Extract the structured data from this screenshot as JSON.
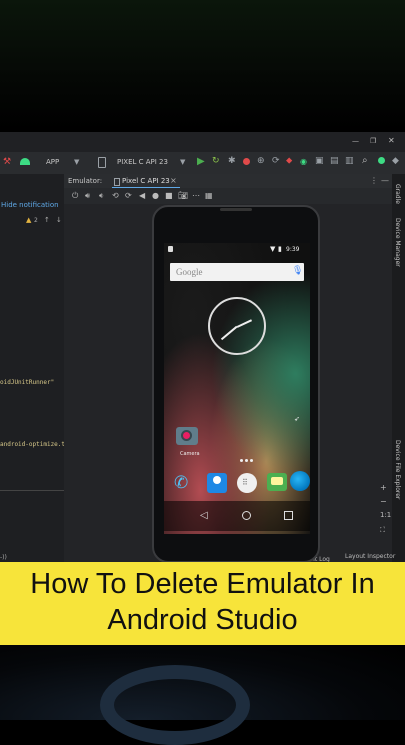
{
  "ide": {
    "run_config": "APP",
    "device_selector": "PIXEL C API 23",
    "left_panel": {
      "hide_notification": "Hide notification",
      "warning_count": "2",
      "code_line_1": "oidJUnitRunner\"",
      "code_line_2": "android-optimize.txt')"
    },
    "emulator_panel": {
      "label": "Emulator:",
      "tab_name": "Pixel C API 23",
      "tab_close": "×"
    },
    "right_tools": {
      "gradle": "Gradle",
      "device_manager": "Device Manager",
      "device_file_explorer": "Device File Explorer"
    },
    "status_bar": {
      "event_log": "Event Log",
      "layout_inspector": "Layout Inspector"
    }
  },
  "phone": {
    "time": "9:39",
    "search_placeholder": "Google",
    "camera_label": "Camera"
  },
  "banner": {
    "line1": "How To Delete Emulator In",
    "line2": "Android Studio"
  },
  "colors": {
    "banner_bg": "#f7e43a",
    "ide_bg": "#2a2c2f",
    "accent_green": "#3ddc84"
  }
}
